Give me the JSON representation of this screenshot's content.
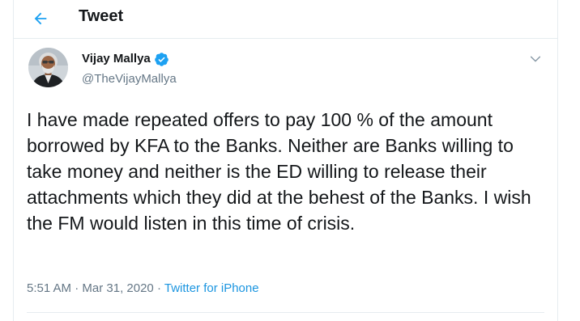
{
  "header": {
    "title": "Tweet",
    "back_icon": "arrow-left-icon"
  },
  "author": {
    "name": "Vijay Mallya",
    "handle": "@TheVijayMallya",
    "verified": true
  },
  "tweet": {
    "text": "I have made repeated offers to pay 100 % of the amount borrowed by KFA to the Banks. Neither are Banks willing to take money and neither is the ED willing to release their attachments which they did at the behest of the Banks. I wish the FM would listen in this time of crisis.",
    "time": "5:51 AM",
    "separator": "·",
    "date": "Mar 31, 2020",
    "source": "Twitter for iPhone"
  },
  "colors": {
    "accent": "#1da1f2",
    "link": "#1b95e0",
    "secondary_text": "#657786",
    "border": "#e6ecf0"
  }
}
